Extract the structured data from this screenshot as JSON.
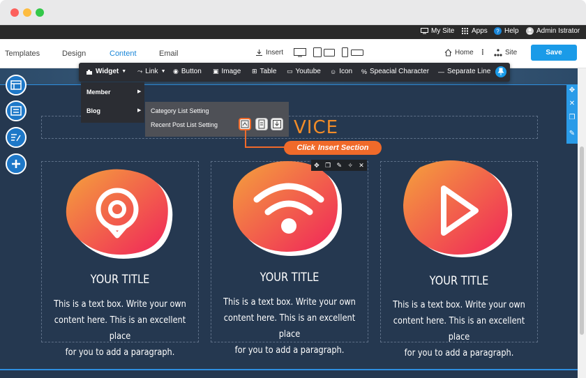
{
  "window": {
    "title_dots": [
      "close",
      "minimize",
      "maximize"
    ]
  },
  "adminbar": {
    "my_site": "My Site",
    "apps": "Apps",
    "help": "Help",
    "user": "Admin Istrator"
  },
  "toolbar": {
    "tabs": [
      "Templates",
      "Design",
      "Content",
      "Email"
    ],
    "active_tab": "Content",
    "insert": "Insert",
    "home": "Home",
    "site": "Site",
    "save_label": "Save"
  },
  "widgetbar": {
    "widget": "Widget",
    "link": "Link",
    "button": "Button",
    "image": "Image",
    "table": "Table",
    "youtube": "Youtube",
    "icon": "Icon",
    "special_character": "Speacial Character",
    "separate_line": "Separate Line"
  },
  "submenu": {
    "member": "Member",
    "blog": "Blog"
  },
  "blog_submenu": {
    "category_list_setting": "Category List Setting",
    "recent_post_list_setting": "Recent Post List Setting"
  },
  "callout": {
    "click": "Click",
    "text": "Insert Section"
  },
  "section": {
    "heading_visible": "VICE"
  },
  "columns": [
    {
      "title": "YOUR TITLE",
      "icon": "location-pin-icon",
      "lines": [
        "This is a text box. Write your own",
        "content here. This is an excellent place",
        "for you to add a paragraph."
      ]
    },
    {
      "title": "YOUR TITLE",
      "icon": "wifi-icon",
      "lines": [
        "This is a text box. Write your own",
        "content here. This is an excellent place",
        "for you to add a paragraph."
      ]
    },
    {
      "title": "YOUR TITLE",
      "icon": "play-icon",
      "lines": [
        "This is a text box. Write your own",
        "content here. This is an excellent place",
        "for you to add a paragraph."
      ]
    }
  ],
  "colors": {
    "accent": "#1a9be8",
    "canvas": "#253850",
    "heading": "#f28c28",
    "callout": "#f06a2a",
    "gradient_start": "#f4a23c",
    "gradient_end": "#f0245a"
  }
}
